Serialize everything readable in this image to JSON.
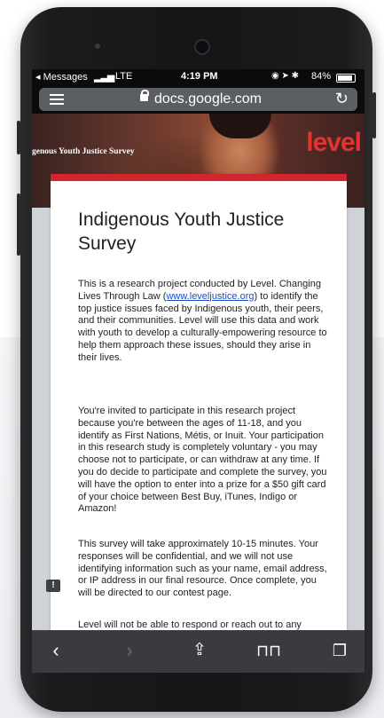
{
  "status_bar": {
    "carrier": "◂ Messages",
    "network": "LTE",
    "time": "4:19 PM",
    "battery": "84%"
  },
  "browser": {
    "url": "docs.google.com"
  },
  "banner": {
    "title": "genous Youth Justice Survey",
    "logo": "level"
  },
  "form": {
    "title": "Indigenous Youth Justice Survey",
    "paragraph1_before_link": "This is a research project conducted by Level. Changing Lives Through Law (",
    "paragraph1_link": "www.leveljustice.org",
    "paragraph1_after_link": ") to identify the top justice issues faced by Indigenous youth, their peers, and their communities. Level will use this data and work with youth to develop a culturally-empowering resource to help them approach these issues, should they arise in their lives.",
    "paragraph2": "You're invited to participate in this research project because you're between the ages of 11-18, and you identify as First Nations, Métis, or Inuit. Your participation in this research study is completely voluntary - you may choose not to participate, or can withdraw at any time. If you do decide to participate and complete the survey, you will have the option to enter into a prize for a $50 gift card of your choice between Best Buy, iTunes, Indigo or Amazon!",
    "paragraph3": "This survey will take approximately 10-15 minutes. Your responses will be confidential, and we will not use identifying information such as your name, email address, or IP address in our final resource. Once complete, you will be directed to our contest page.",
    "paragraph4_partial": "Level will not be able to respond or reach out to any"
  },
  "toolbar": {
    "back": "back-icon",
    "forward": "forward-icon",
    "share": "share-icon",
    "bookmarks": "bookmarks-icon",
    "tabs": "tabs-icon"
  }
}
